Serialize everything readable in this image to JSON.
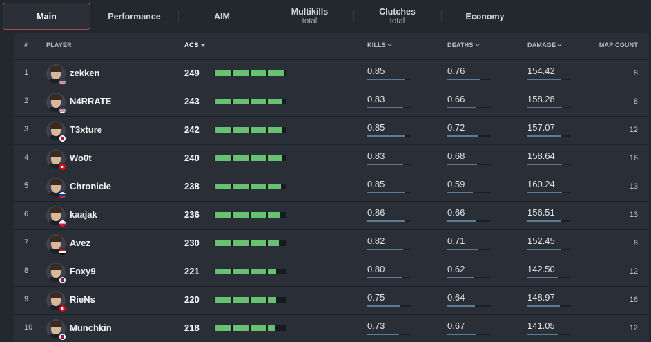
{
  "tabs": [
    {
      "label": "Main",
      "sub": ""
    },
    {
      "label": "Performance",
      "sub": ""
    },
    {
      "label": "AIM",
      "sub": ""
    },
    {
      "label": "Multikills",
      "sub": "total"
    },
    {
      "label": "Clutches",
      "sub": "total"
    },
    {
      "label": "Economy",
      "sub": ""
    }
  ],
  "table": {
    "headers": {
      "rank": "#",
      "player": "PLAYER",
      "acs": "ACS",
      "kills": "KILLS",
      "deaths": "DEATHS",
      "damage": "DAMAGE",
      "map_count": "MAP COUNT"
    },
    "rows": [
      {
        "rank": "1",
        "player": "zekken",
        "acs": "249",
        "kills": "0.85",
        "deaths": "0.76",
        "damage": "154.42",
        "map_count": "8",
        "flag": "us"
      },
      {
        "rank": "2",
        "player": "N4RRATE",
        "acs": "243",
        "kills": "0.83",
        "deaths": "0.66",
        "damage": "158.28",
        "map_count": "8",
        "flag": "us"
      },
      {
        "rank": "3",
        "player": "T3xture",
        "acs": "242",
        "kills": "0.85",
        "deaths": "0.72",
        "damage": "157.07",
        "map_count": "12",
        "flag": "kr"
      },
      {
        "rank": "4",
        "player": "Wo0t",
        "acs": "240",
        "kills": "0.83",
        "deaths": "0.68",
        "damage": "158.64",
        "map_count": "16",
        "flag": "tr"
      },
      {
        "rank": "5",
        "player": "Chronicle",
        "acs": "238",
        "kills": "0.85",
        "deaths": "0.59",
        "damage": "160.24",
        "map_count": "13",
        "flag": "ru"
      },
      {
        "rank": "6",
        "player": "kaajak",
        "acs": "236",
        "kills": "0.86",
        "deaths": "0.66",
        "damage": "156.51",
        "map_count": "13",
        "flag": "pl"
      },
      {
        "rank": "7",
        "player": "Avez",
        "acs": "230",
        "kills": "0.82",
        "deaths": "0.71",
        "damage": "152.45",
        "map_count": "8",
        "flag": "eg"
      },
      {
        "rank": "8",
        "player": "Foxy9",
        "acs": "221",
        "kills": "0.80",
        "deaths": "0.62",
        "damage": "142.50",
        "map_count": "12",
        "flag": "kr"
      },
      {
        "rank": "9",
        "player": "RieNs",
        "acs": "220",
        "kills": "0.75",
        "deaths": "0.64",
        "damage": "148.97",
        "map_count": "16",
        "flag": "tr"
      },
      {
        "rank": "10",
        "player": "Munchkin",
        "acs": "218",
        "kills": "0.73",
        "deaths": "0.67",
        "damage": "141.05",
        "map_count": "12",
        "flag": "kr"
      }
    ]
  },
  "colors": {
    "bar_fill": "#67c172",
    "underline_fill": "#5a7c95",
    "active_tab_border": "#b9434c"
  }
}
